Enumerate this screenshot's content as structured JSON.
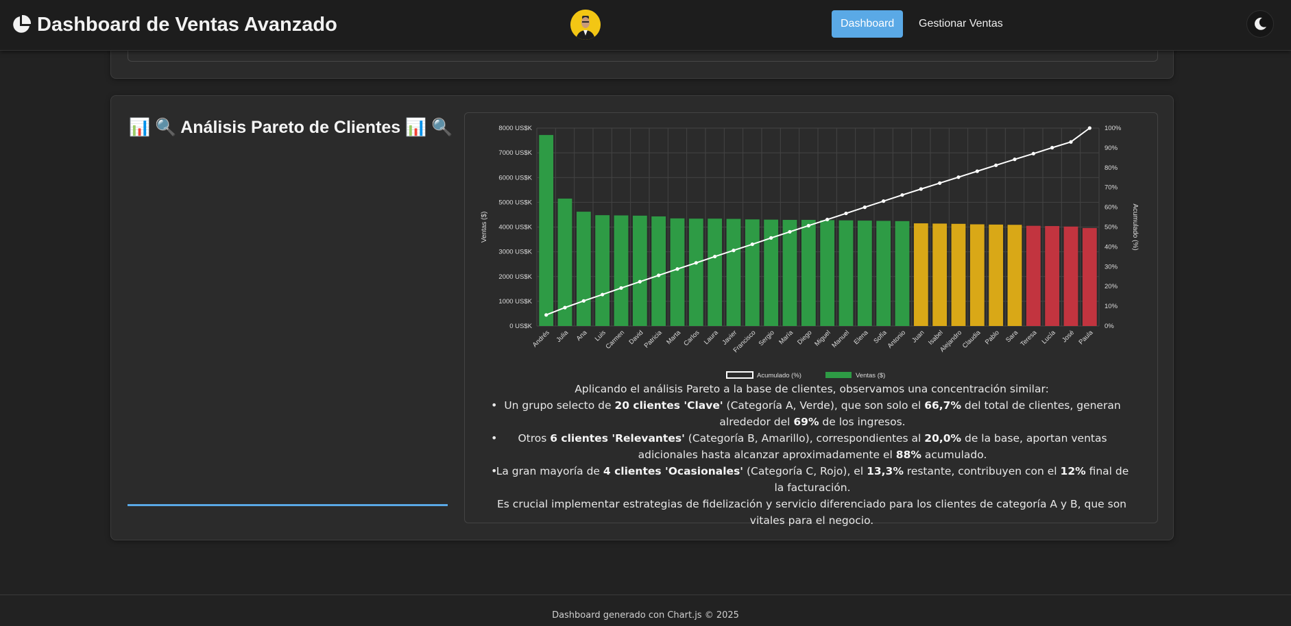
{
  "navbar": {
    "title": "Dashboard de Ventas Avanzado",
    "brand_icon": "pie-chart-icon",
    "links": [
      {
        "label": "Dashboard",
        "active": true
      },
      {
        "label": "Gestionar Ventas",
        "active": false
      }
    ],
    "theme_icon": "moon-icon"
  },
  "pareto": {
    "title": "📊 🔍 Análisis Pareto de Clientes 📊 🔍"
  },
  "analysis": {
    "intro": "Aplicando el análisis Pareto a la base de clientes, observamos una concentración similar:",
    "a": {
      "t1": "Un grupo selecto de ",
      "b1": "20 clientes 'Clave'",
      "t2": " (Categoría A, Verde), que son solo el ",
      "b2": "66,7%",
      "t3": " del total de clientes, generan alrededor del ",
      "b3": "69%",
      "t4": " de los ingresos."
    },
    "b": {
      "t1": "Otros ",
      "b1": "6 clientes 'Relevantes'",
      "t2": " (Categoría B, Amarillo), correspondientes al ",
      "b2": "20,0%",
      "t3": " de la base, aportan ventas adicionales hasta alcanzar aproximadamente el ",
      "b3": "88%",
      "t4": " acumulado."
    },
    "c": {
      "t1": "La gran mayoría de ",
      "b1": "4 clientes 'Ocasionales'",
      "t2": " (Categoría C, Rojo), el ",
      "b2": "13,3%",
      "t3": " restante, contribuyen con el ",
      "b3": "12%",
      "t4": " final de la facturación."
    },
    "conclusion": "Es crucial implementar estrategias de fidelización y servicio diferenciado para los clientes de categoría A y B, que son vitales para el negocio."
  },
  "footer": {
    "text": "Dashboard generado con Chart.js © 2025"
  },
  "chart_data": {
    "type": "bar",
    "categories": [
      "Andrés",
      "Julia",
      "Ana",
      "Luis",
      "Carmen",
      "David",
      "Patricia",
      "Marta",
      "Carlos",
      "Laura",
      "Javier",
      "Francisco",
      "Sergio",
      "María",
      "Diego",
      "Miguel",
      "Manuel",
      "Elena",
      "Sofía",
      "Antonio",
      "Juan",
      "Isabel",
      "Alejandro",
      "Claudia",
      "Pablo",
      "Sara",
      "Teresa",
      "Lucía",
      "José",
      "Paula"
    ],
    "series": [
      {
        "name": "Ventas ($)",
        "type": "bar",
        "axis": "left",
        "values": [
          7720,
          5150,
          4620,
          4480,
          4470,
          4460,
          4430,
          4350,
          4340,
          4340,
          4330,
          4310,
          4300,
          4290,
          4290,
          4280,
          4270,
          4260,
          4250,
          4240,
          4150,
          4140,
          4130,
          4110,
          4100,
          4090,
          4050,
          4040,
          4020,
          3960
        ],
        "category_colors": {
          "A": "#2e9b45",
          "B": "#d9a817",
          "C": "#c2343f"
        },
        "categories_abc": [
          "A",
          "A",
          "A",
          "A",
          "A",
          "A",
          "A",
          "A",
          "A",
          "A",
          "A",
          "A",
          "A",
          "A",
          "A",
          "A",
          "A",
          "A",
          "A",
          "A",
          "B",
          "B",
          "B",
          "B",
          "B",
          "B",
          "C",
          "C",
          "C",
          "C"
        ]
      },
      {
        "name": "Acumulado (%)",
        "type": "line",
        "axis": "right",
        "values": [
          5.6,
          9.3,
          12.7,
          15.9,
          19.2,
          22.4,
          25.6,
          28.8,
          31.9,
          35.1,
          38.2,
          41.3,
          44.5,
          47.6,
          50.7,
          53.8,
          56.9,
          60.0,
          63.1,
          66.2,
          69.2,
          72.2,
          75.2,
          78.2,
          81.2,
          84.2,
          87.1,
          90.1,
          93.0,
          100.0
        ],
        "color": "#ffffff"
      }
    ],
    "y_left": {
      "label": "Ventas ($)",
      "min": 0,
      "max": 8000,
      "step": 1000,
      "tick_suffix": " US$K"
    },
    "y_right": {
      "label": "Acumulado (%)",
      "min": 0,
      "max": 100,
      "step": 10,
      "tick_suffix": "%"
    },
    "grid": true,
    "legend": {
      "position": "bottom",
      "items": [
        "Acumulado (%)",
        "Ventas ($)"
      ]
    }
  }
}
